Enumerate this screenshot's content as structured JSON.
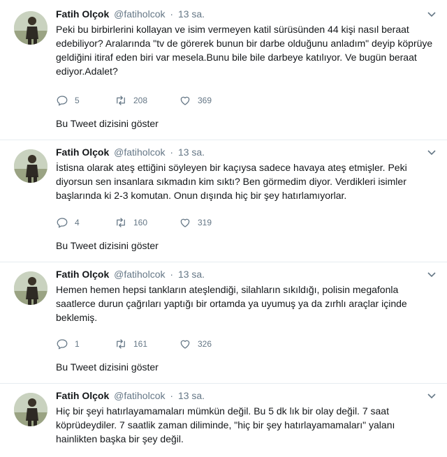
{
  "tweets": [
    {
      "author_name": "Fatih Olçok",
      "handle": "@fatiholcok",
      "dot": "·",
      "time": "13 sa.",
      "text": "Peki bu birbirlerini kollayan ve isim vermeyen katil sürüsünden 44 kişi nasıl beraat edebiliyor? Aralarında \"tv de görerek bunun bir darbe olduğunu anladım\" deyip köprüye geldiğini itiraf eden biri var mesela.Bunu bile bile darbeye katılıyor. Ve bugün beraat ediyor.Adalet?",
      "replies": "5",
      "retweets": "208",
      "likes": "369",
      "thread_link": "Bu Tweet dizisini göster"
    },
    {
      "author_name": "Fatih Olçok",
      "handle": "@fatiholcok",
      "dot": "·",
      "time": "13 sa.",
      "text": "İstisna olarak ateş ettiğini söyleyen bir kaçıysa sadece havaya ateş etmişler. Peki diyorsun sen insanlara sıkmadın kim sıktı? Ben görmedim diyor. Verdikleri isimler başlarında ki 2-3 komutan. Onun dışında hiç bir şey hatırlamıyorlar.",
      "replies": "4",
      "retweets": "160",
      "likes": "319",
      "thread_link": "Bu Tweet dizisini göster"
    },
    {
      "author_name": "Fatih Olçok",
      "handle": "@fatiholcok",
      "dot": "·",
      "time": "13 sa.",
      "text": "Hemen hemen hepsi tankların ateşlendiği, silahların sıkıldığı, polisin megafonla saatlerce durun çağrıları yaptığı bir ortamda ya uyumuş ya da zırhlı araçlar içinde beklemiş.",
      "replies": "1",
      "retweets": "161",
      "likes": "326",
      "thread_link": "Bu Tweet dizisini göster"
    },
    {
      "author_name": "Fatih Olçok",
      "handle": "@fatiholcok",
      "dot": "·",
      "time": "13 sa.",
      "text": "Hiç bir şeyi hatırlayamamaları mümkün değil. Bu 5 dk lık bir olay değil. 7 saat köprüdeydiler. 7 saatlik zaman diliminde, \"hiç bir şey hatırlayamamaları\" yalanı hainlikten başka bir şey değil."
    }
  ],
  "colors": {
    "text": "#14171a",
    "secondary": "#657786",
    "separator": "#e6ecf0"
  },
  "icons": [
    "reply-icon",
    "retweet-icon",
    "like-icon",
    "chevron-down-icon"
  ]
}
